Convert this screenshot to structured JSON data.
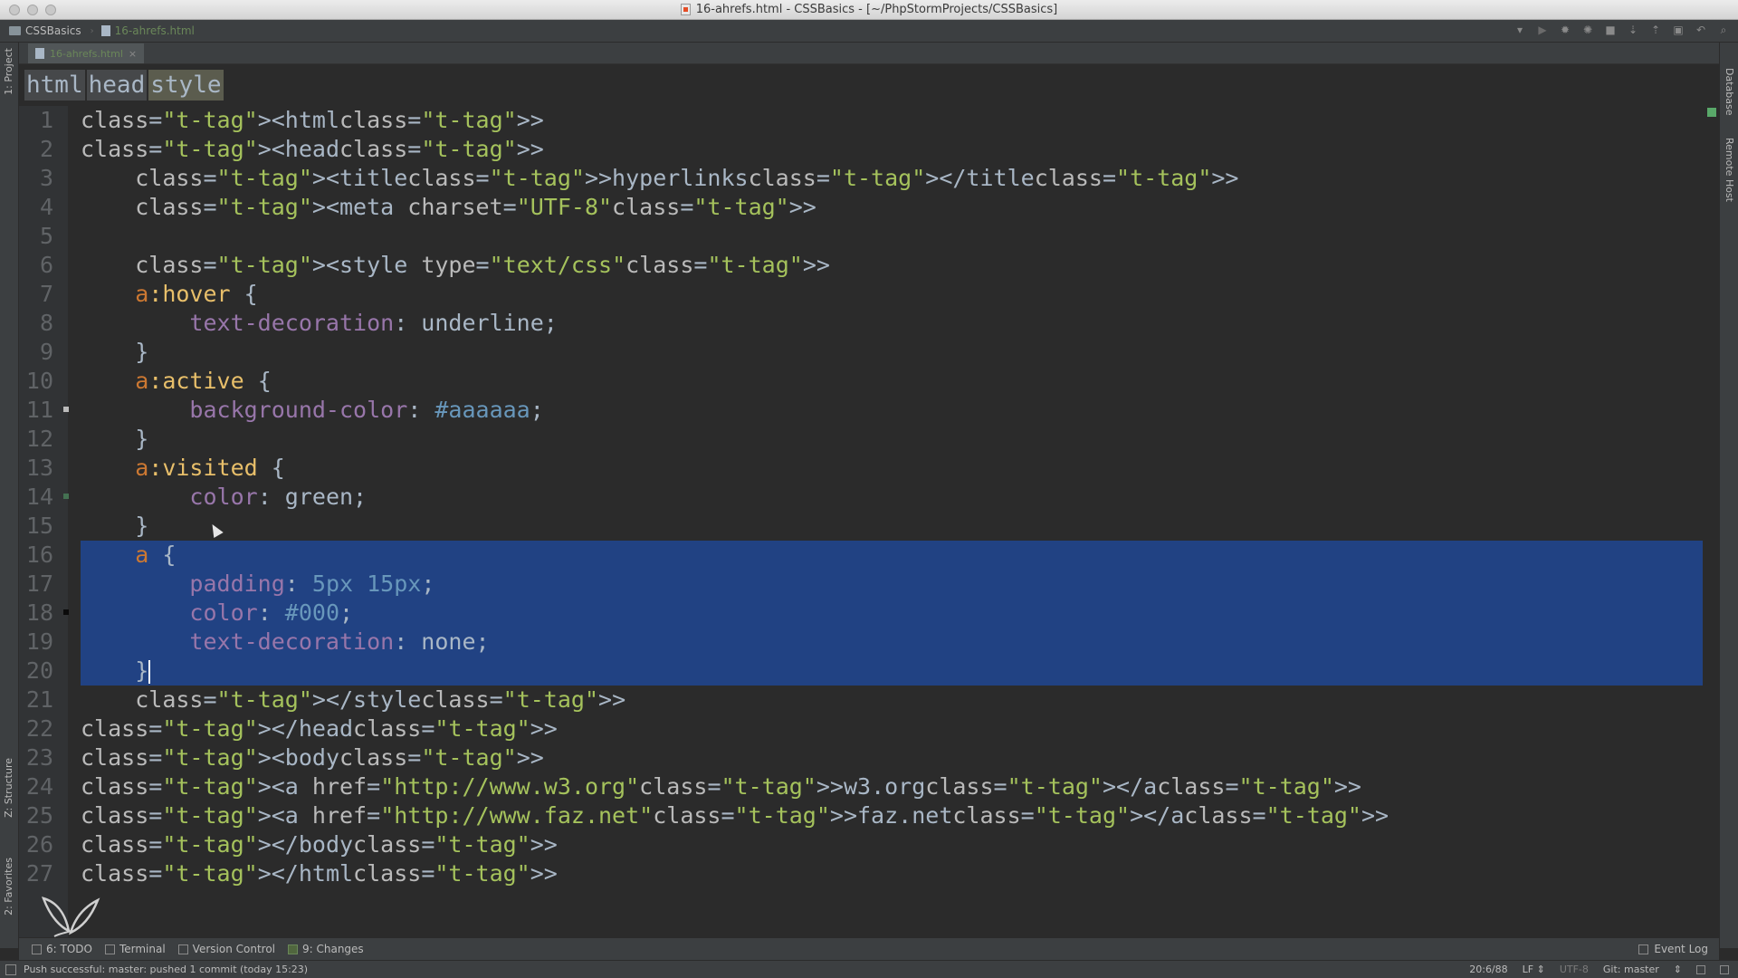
{
  "window": {
    "title": "16-ahrefs.html - CSSBasics - [~/PhpStormProjects/CSSBasics]"
  },
  "nav": {
    "project": "CSSBasics",
    "file": "16-ahrefs.html"
  },
  "side_tabs": {
    "project": "1: Project",
    "structure": "Z: Structure",
    "favorites": "2: Favorites",
    "database": "Database",
    "remote_host": "Remote Host"
  },
  "editor_tab": {
    "label": "16-ahrefs.html",
    "close": "×"
  },
  "breadcrumbs": [
    "html",
    "head",
    "style"
  ],
  "code_lines": [
    "<html>",
    "<head>",
    "    <title>hyperlinks</title>",
    "    <meta charset=\"UTF-8\">",
    "",
    "    <style type=\"text/css\">",
    "    a:hover {",
    "        text-decoration: underline;",
    "    }",
    "    a:active {",
    "        background-color: #aaaaaa;",
    "    }",
    "    a:visited {",
    "        color: green;",
    "    }",
    "    a {",
    "        padding: 5px 15px;",
    "        color: #000;",
    "        text-decoration: none;",
    "    }",
    "    </style>",
    "</head>",
    "<body>",
    "<a href=\"http://www.w3.org\">w3.org</a>",
    "<a href=\"http://www.faz.net\">faz.net</a>",
    "</body>",
    "</html>"
  ],
  "bottom_tools": {
    "todo": "6: TODO",
    "terminal": "Terminal",
    "version_control": "Version Control",
    "changes": "9: Changes",
    "event_log": "Event Log"
  },
  "status": {
    "message": "Push successful: master: pushed 1 commit (today 15:23)",
    "position": "20:6/88",
    "line_sep": "LF ⇕",
    "encoding": "UTF-8",
    "git": "Git: master",
    "git_arrows": "⇕"
  },
  "colors": {
    "editor_bg": "#2b2b2b",
    "selection": "#214283",
    "tag": "#e8bf6a",
    "string": "#a5c25c",
    "property": "#9876aa",
    "number": "#6897bb"
  }
}
